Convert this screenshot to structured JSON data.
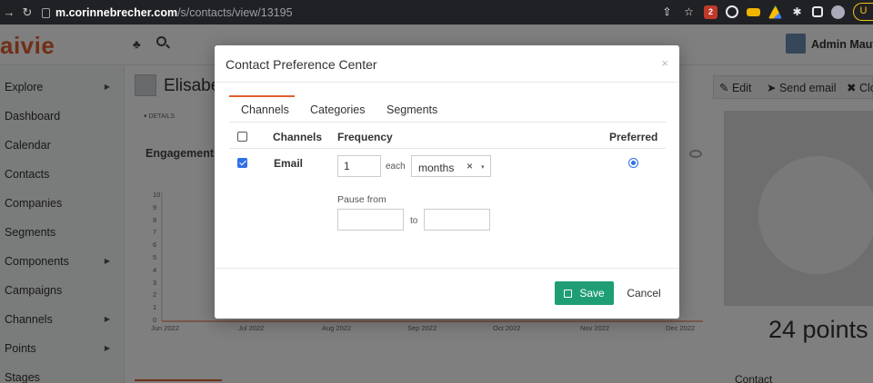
{
  "browser": {
    "host": "m.corinnebrecher.com",
    "path": "/s/contacts/view/13195",
    "profile_initial": "U",
    "ext_badge": "2"
  },
  "app": {
    "brand": "aivie",
    "admin_name": "Admin Mauti",
    "sidebar": {
      "items": [
        {
          "label": "Explore",
          "has_caret": true
        },
        {
          "label": "Dashboard",
          "has_caret": false
        },
        {
          "label": "Calendar",
          "has_caret": false
        },
        {
          "label": "Contacts",
          "has_caret": false
        },
        {
          "label": "Companies",
          "has_caret": false
        },
        {
          "label": "Segments",
          "has_caret": false
        },
        {
          "label": "Components",
          "has_caret": true
        },
        {
          "label": "Campaigns",
          "has_caret": false
        },
        {
          "label": "Channels",
          "has_caret": true
        },
        {
          "label": "Points",
          "has_caret": true
        },
        {
          "label": "Stages",
          "has_caret": false
        }
      ]
    },
    "contact": {
      "name_partial": "Elisabet",
      "details_label": "▾ DETAILS",
      "engagements_title": "Engagements",
      "points": "24 points",
      "contact_section": "Contact"
    },
    "actions": {
      "edit": "✎ Edit",
      "send_email": "➤ Send email",
      "close": "✖ Clo"
    },
    "chart": {
      "y_ticks": [
        "10",
        "9",
        "8",
        "7",
        "6",
        "5",
        "4",
        "3",
        "2",
        "1",
        "0"
      ],
      "x_ticks": [
        "Jun 2022",
        "Jul 2022",
        "Aug 2022",
        "Sep 2022",
        "Oct 2022",
        "Nov 2022",
        "Dec 2022"
      ]
    }
  },
  "modal": {
    "title": "Contact Preference Center",
    "close_glyph": "×",
    "tabs": [
      {
        "label": "Channels",
        "active": true
      },
      {
        "label": "Categories",
        "active": false
      },
      {
        "label": "Segments",
        "active": false
      }
    ],
    "table": {
      "headers": {
        "channels": "Channels",
        "frequency": "Frequency",
        "preferred": "Preferred"
      },
      "row": {
        "channel": "Email",
        "checked": true,
        "frequency_number": "1",
        "each_label": "each",
        "period": "months",
        "clear_glyph": "×",
        "arrow_glyph": "▾",
        "preferred": true,
        "pause_label": "Pause from",
        "pause_from": "",
        "to_label": "to",
        "pause_to": ""
      }
    },
    "footer": {
      "save_label": "Save",
      "cancel_label": "Cancel"
    }
  },
  "colors": {
    "brand": "#e15f2f",
    "save": "#1f9e75",
    "checkbox": "#2f71e6"
  }
}
